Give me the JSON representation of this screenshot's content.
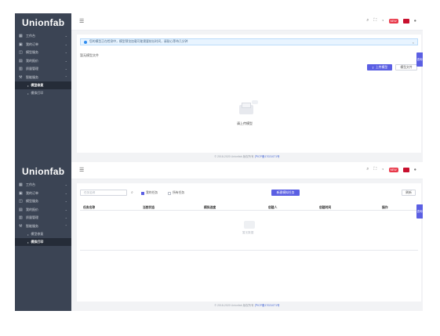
{
  "brand": {
    "logo_text": "Unionfab"
  },
  "sidebar": {
    "items": [
      {
        "icon": "grid-icon",
        "label": "工作台"
      },
      {
        "icon": "box-icon",
        "label": "我的订单"
      },
      {
        "icon": "cube-icon",
        "label": "模型服务"
      },
      {
        "icon": "chart-icon",
        "label": "我的报价"
      },
      {
        "icon": "book-icon",
        "label": "质量管理"
      },
      {
        "icon": "tool-icon",
        "label": "智能服务"
      }
    ],
    "sub_items": [
      "模型修复",
      "模拟打印"
    ]
  },
  "topbar": {
    "menu_icon": "hamburger-icon",
    "new_badge": "NEW"
  },
  "screen1": {
    "alert": "您的模型正在检测中，模型预览加载可能需要较长时间，请耐心等待几分钟",
    "alert_close": "×",
    "section_label": "暂无模型文件",
    "upload_button": "上传模型",
    "secondary_button": "模型文件",
    "upload_hint": "请上传模型",
    "active_sub": 0
  },
  "screen2": {
    "search_placeholder": "任务名称",
    "checkbox_mine": "我的任务",
    "checkbox_all": "所有任务",
    "new_task_button": "新建模拟任务",
    "refresh_button": "刷新",
    "columns": [
      "任务名称",
      "当前状态",
      "模拟进度",
      "创建人",
      "创建时间",
      "操作"
    ],
    "empty_text": "暂无数据",
    "active_sub": 1
  },
  "footer": {
    "copyright": "© 2018-2020 Unionfab 版权所有",
    "icp": "沪ICP备17021071号"
  },
  "side_tab_label": "咨询",
  "colors": {
    "sidebar": "#3b4454",
    "accent": "#5b5fe3",
    "active": "#252c38"
  }
}
